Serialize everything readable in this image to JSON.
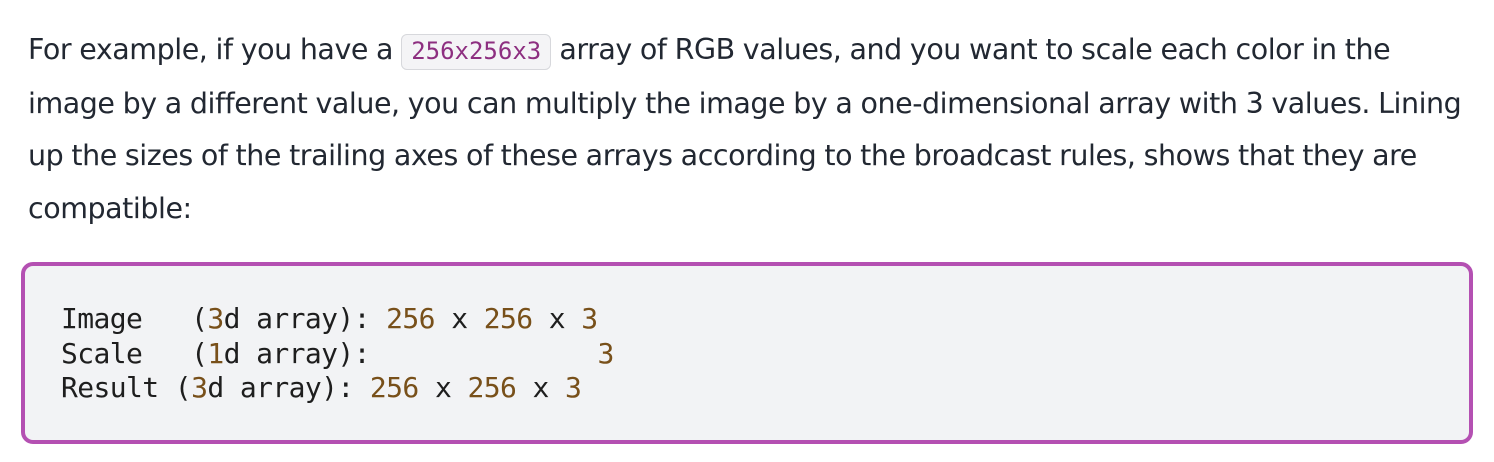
{
  "paragraph": {
    "before_code": "For example, if you have a ",
    "inline_code": "256x256x3",
    "after_code": " array of RGB values, and you want to scale each color in the image by a different value, you can multiply the image by a one-dimensional array with 3 values. Lining up the sizes of the trailing axes of these arrays according to the broadcast rules, shows that they are compatible:"
  },
  "code_block": {
    "lines": [
      {
        "label": "Image  ",
        "open": " (",
        "dim": "3",
        "kind": "d array): ",
        "size_a": "256",
        "x1": " x ",
        "size_b": "256",
        "x2": " x ",
        "size_c": "3"
      },
      {
        "label": "Scale  ",
        "open": " (",
        "dim": "1",
        "kind": "d array): ",
        "size_a": "",
        "x1": "          ",
        "size_b": "",
        "x2": "   ",
        "size_c": "3"
      },
      {
        "label": "Result",
        "open": " (",
        "dim": "3",
        "kind": "d array): ",
        "size_a": "256",
        "x1": " x ",
        "size_b": "256",
        "x2": " x ",
        "size_c": "3"
      }
    ]
  },
  "colors": {
    "text": "#222832",
    "inline_code_text": "#8d2f80",
    "code_border": "#b450b2",
    "code_background": "#f2f3f5",
    "code_number": "#78501a"
  }
}
